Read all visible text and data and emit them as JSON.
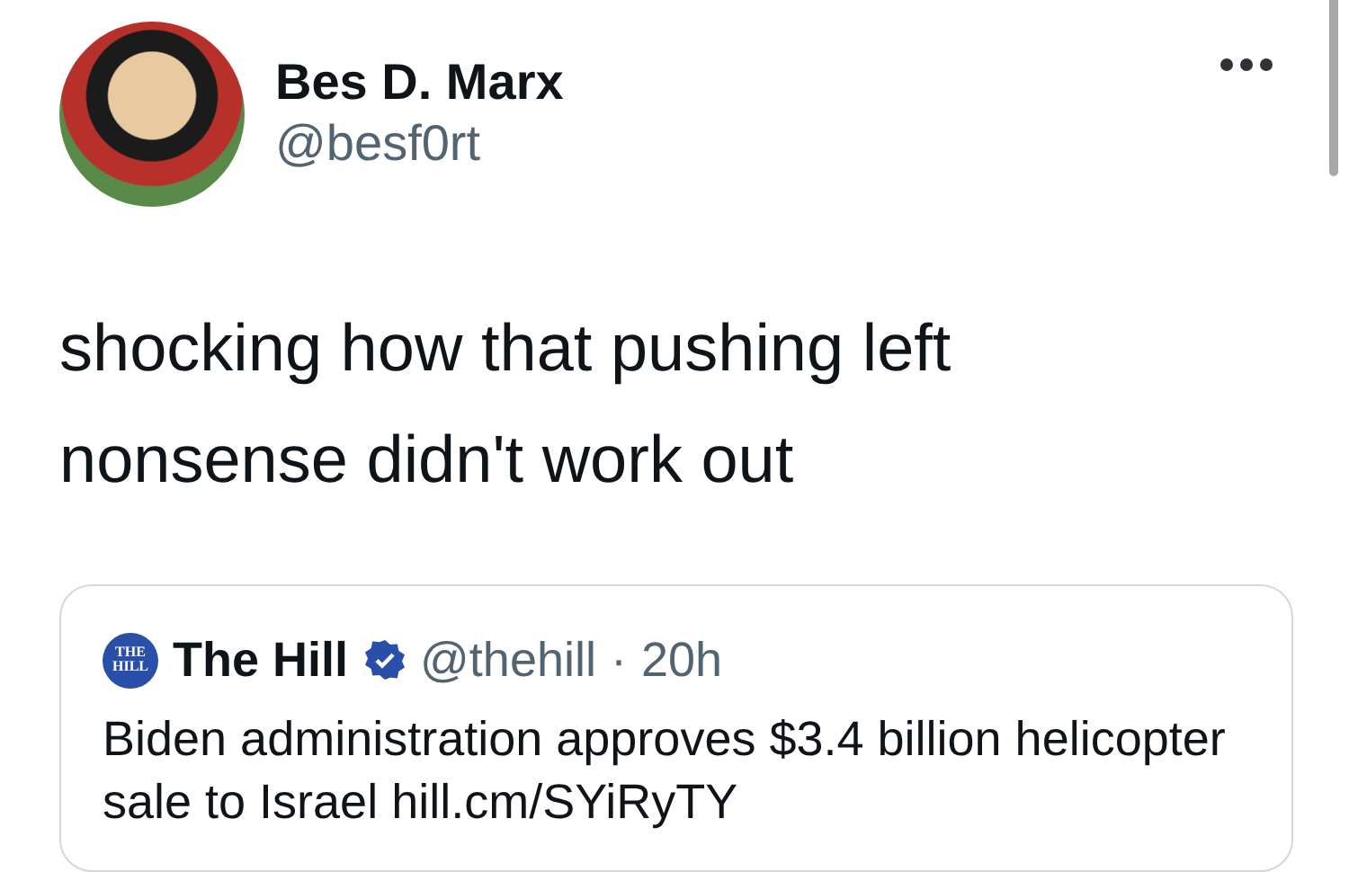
{
  "author": {
    "name": "Bes D. Marx",
    "handle": "@besf0rt"
  },
  "tweet_text": "shocking how that pushing left nonsense didn't work out",
  "quoted_tweet": {
    "logo_text": "THE HILL",
    "name": "The Hill",
    "verified": true,
    "handle": "@thehill",
    "separator": "·",
    "time": "20h",
    "text": "Biden administration approves $3.4 billion helicopter sale to Israel hill.cm/SYiRyTY"
  }
}
